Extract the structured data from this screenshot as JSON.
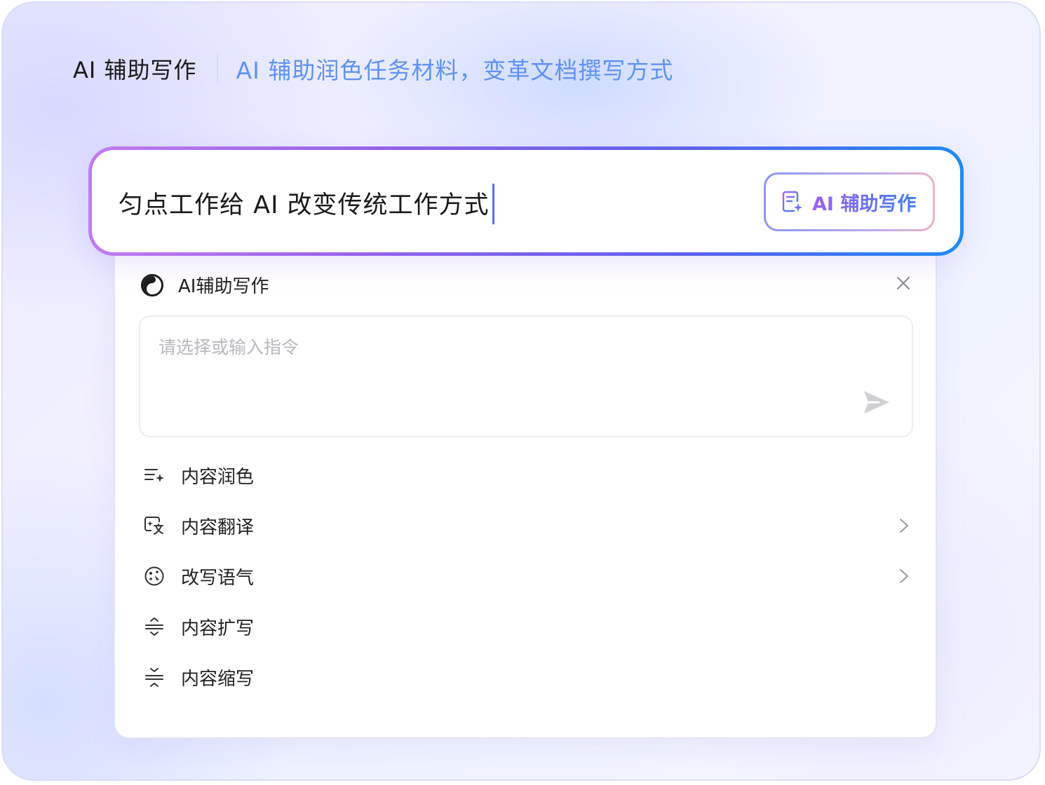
{
  "header": {
    "title": "AI 辅助写作",
    "subtitle": "AI 辅助润色任务材料，变革文档撰写方式"
  },
  "input_bar": {
    "text": "匀点工作给 AI 改变传统工作方式",
    "button_label": "AI 辅助写作",
    "button_icon": "document-sparkle-icon"
  },
  "panel": {
    "title": "AI辅助写作",
    "logo_icon": "ai-logo-icon",
    "close_icon": "close-icon",
    "command_input": {
      "value": "",
      "placeholder": "请选择或输入指令"
    },
    "send_icon": "send-icon",
    "menu": [
      {
        "label": "内容润色",
        "icon": "polish-icon",
        "has_submenu": false
      },
      {
        "label": "内容翻译",
        "icon": "translate-icon",
        "has_submenu": true
      },
      {
        "label": "改写语气",
        "icon": "tone-icon",
        "has_submenu": true
      },
      {
        "label": "内容扩写",
        "icon": "expand-icon",
        "has_submenu": false
      },
      {
        "label": "内容缩写",
        "icon": "shrink-icon",
        "has_submenu": false
      }
    ]
  },
  "colors": {
    "accent_blue": "#5f92f3",
    "gradient_start": "#c37bf0",
    "gradient_end": "#1f8af4"
  }
}
